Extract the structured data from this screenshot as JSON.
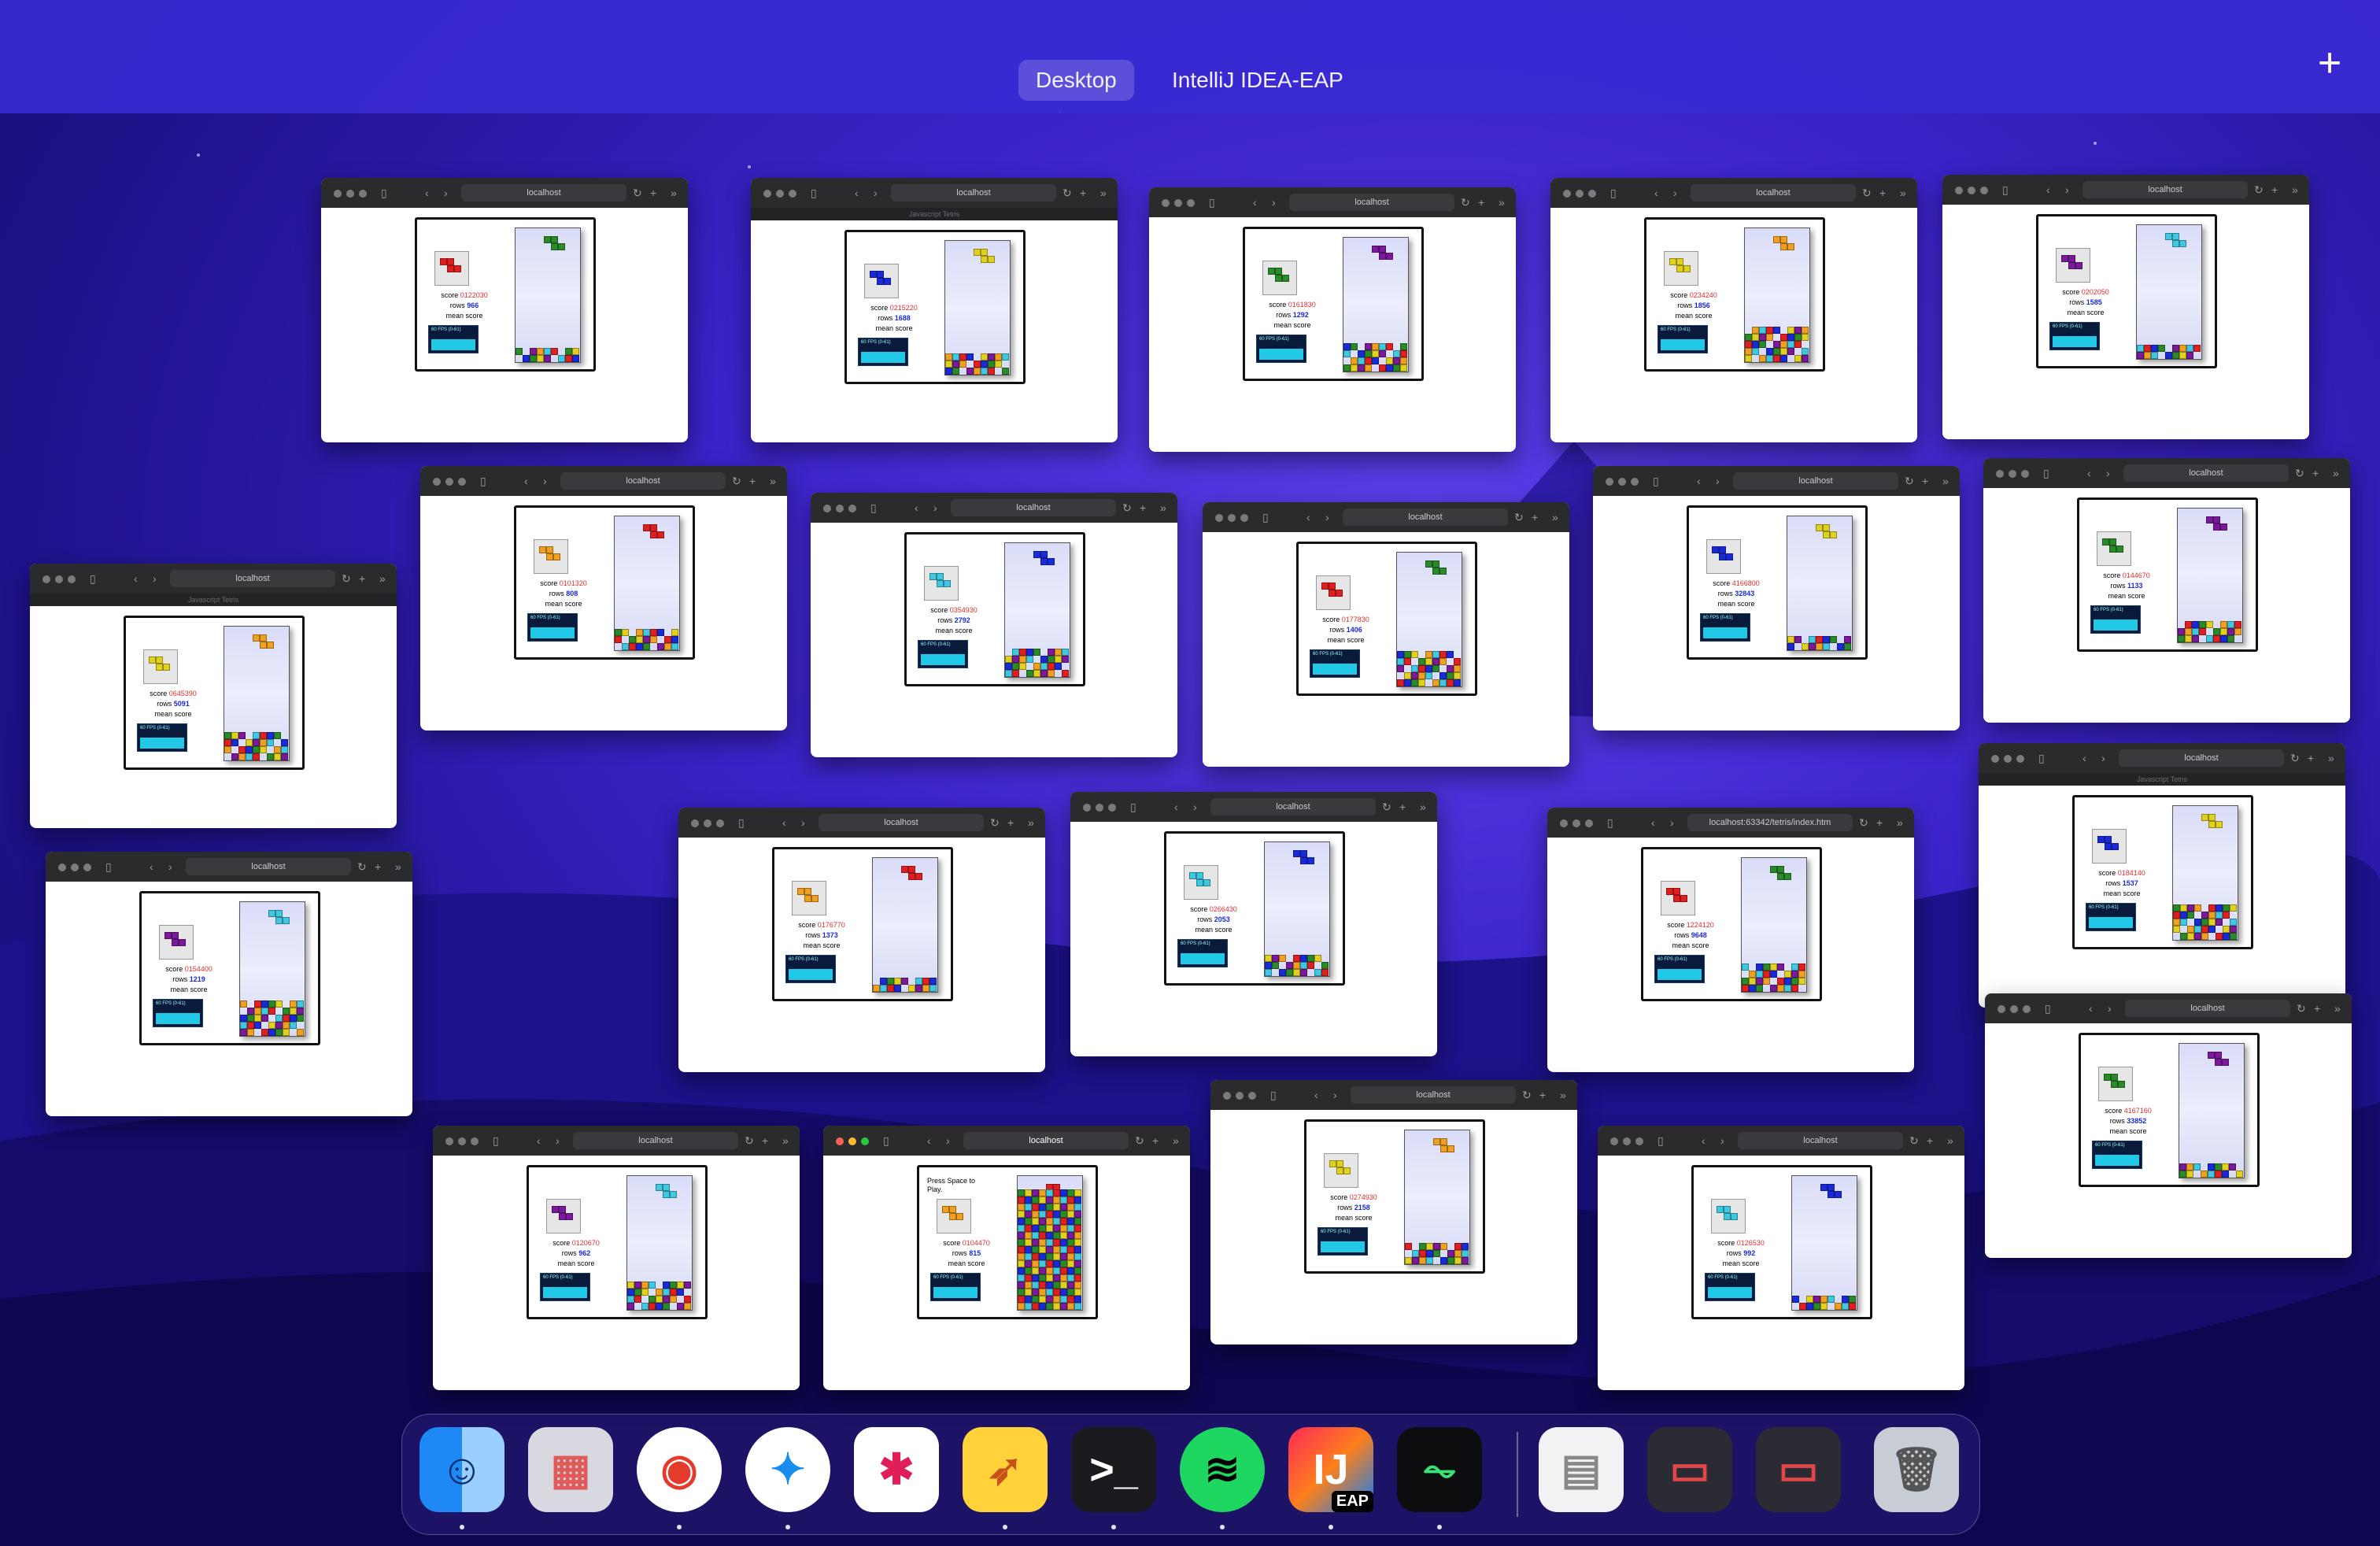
{
  "spaces_bar": {
    "tabs": [
      {
        "label": "Desktop",
        "active": true
      },
      {
        "label": "IntelliJ IDEA-EAP",
        "active": false
      }
    ],
    "add_label": "+"
  },
  "windows": [
    {
      "url": "localhost",
      "score": "0122030",
      "rows": "966",
      "tab_title": ""
    },
    {
      "url": "localhost",
      "score": "0215220",
      "rows": "1688",
      "tab_title": "Javascript Tetris"
    },
    {
      "url": "localhost",
      "score": "0161830",
      "rows": "1292",
      "tab_title": ""
    },
    {
      "url": "localhost",
      "score": "0234240",
      "rows": "1856",
      "tab_title": ""
    },
    {
      "url": "localhost",
      "score": "0202050",
      "rows": "1585",
      "tab_title": ""
    },
    {
      "url": "localhost",
      "score": "0101320",
      "rows": "808",
      "tab_title": ""
    },
    {
      "url": "localhost",
      "score": "0354930",
      "rows": "2792",
      "tab_title": ""
    },
    {
      "url": "localhost",
      "score": "0177830",
      "rows": "1406",
      "tab_title": ""
    },
    {
      "url": "localhost",
      "score": "4166800",
      "rows": "32843",
      "tab_title": ""
    },
    {
      "url": "localhost",
      "score": "0144670",
      "rows": "1133",
      "tab_title": ""
    },
    {
      "url": "localhost",
      "score": "0645390",
      "rows": "5091",
      "tab_title": "Javascript Tetris"
    },
    {
      "url": "localhost",
      "score": "0154400",
      "rows": "1219",
      "tab_title": ""
    },
    {
      "url": "localhost",
      "score": "0176770",
      "rows": "1373",
      "tab_title": ""
    },
    {
      "url": "localhost",
      "score": "0266430",
      "rows": "2053",
      "tab_title": ""
    },
    {
      "url": "localhost:63342/tetris/index.htm",
      "score": "1224120",
      "rows": "9648",
      "tab_title": ""
    },
    {
      "url": "localhost",
      "score": "0184140",
      "rows": "1537",
      "tab_title": "Javascript Tetris"
    },
    {
      "url": "localhost",
      "score": "4167160",
      "rows": "33852",
      "tab_title": ""
    },
    {
      "url": "localhost",
      "score": "0274930",
      "rows": "2158",
      "tab_title": ""
    },
    {
      "url": "localhost",
      "score": "0120670",
      "rows": "962",
      "tab_title": ""
    },
    {
      "url": "localhost",
      "score": "0104470",
      "rows": "815",
      "tab_title": "",
      "message": "Press Space to Play."
    },
    {
      "url": "localhost",
      "score": "0126530",
      "rows": "992",
      "tab_title": ""
    }
  ],
  "game_labels": {
    "score": "score",
    "rows": "rows",
    "mean": "mean score",
    "fps": "60 FPS (0-61)"
  },
  "dock": {
    "apps": [
      {
        "name": "Finder",
        "icon": "finder-icon",
        "running": true
      },
      {
        "name": "Launchpad",
        "icon": "launchpad-icon",
        "running": false
      },
      {
        "name": "Google Chrome",
        "icon": "chrome-icon",
        "running": true
      },
      {
        "name": "Safari",
        "icon": "safari-icon",
        "running": true
      },
      {
        "name": "Slack",
        "icon": "slack-icon",
        "running": false
      },
      {
        "name": "Cyberduck",
        "icon": "duck-icon",
        "running": true
      },
      {
        "name": "Terminal",
        "icon": "terminal-icon",
        "running": true
      },
      {
        "name": "Spotify",
        "icon": "spotify-icon",
        "running": true
      },
      {
        "name": "IntelliJ IDEA EAP",
        "icon": "intellij-icon",
        "running": true,
        "badge": "EAP"
      },
      {
        "name": "Activity Monitor",
        "icon": "activity-monitor-icon",
        "running": true
      }
    ],
    "recent": [
      {
        "name": "Document",
        "icon": "document-icon"
      },
      {
        "name": "Minimized window",
        "icon": "window-thumbnail-icon"
      },
      {
        "name": "Minimized window",
        "icon": "window-thumbnail-icon"
      },
      {
        "name": "Trash",
        "icon": "trash-icon"
      }
    ]
  }
}
